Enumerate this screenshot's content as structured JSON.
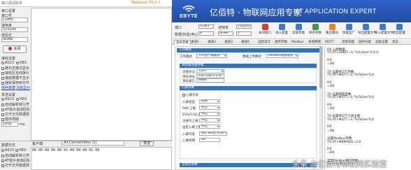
{
  "left_app": {
    "title": "串口调试助手",
    "right_title": "NetAssist V5.0.3",
    "panel": {
      "settings_header": "串口设置",
      "port_label": "串口号",
      "port_value": "COM5",
      "baud_label": "波特率",
      "baud_value": "115200",
      "parity_label": "校验位",
      "parity_value": "NONE",
      "open_button": "关闭",
      "recv_header": "接收设置",
      "recv_ascii": "ASCII",
      "recv_hex": "HEX",
      "recv_opt1": "按日志模式显示",
      "recv_opt2": "接收区自动换行",
      "recv_opt3": "接收数据不显示",
      "recv_opt4": "接收保存到文件",
      "link_save": "保存数据",
      "link_clear": "清除显示",
      "send_header": "发送设置",
      "send_ascii": "ASCII",
      "send_hex": "HEX",
      "send_opt1": "自动解析转义符",
      "send_opt2": "AT指令自动回车",
      "send_opt3": "打开文件数据源",
      "send_opt4": "循环周期",
      "cycle_value": "1000",
      "cycle_unit": "ms"
    },
    "bottom_bar": {
      "data_log": "数据日志",
      "client_label": "客户端:",
      "conn_value": "All Connections (1)",
      "send_button": "发送",
      "send_content": "00 00 00 00 00 01 00 00 00 01 00"
    }
  },
  "right_app": {
    "brand": "EBYTE",
    "title": "亿佰特 · 物联网应用专家",
    "subtitle": "IoT APPLICATION EXPERT",
    "toolbar": {
      "port_label": "端口",
      "port_value": "COM5",
      "baud_label": "波特率",
      "baud_value": "115200",
      "format_label": "数据/校验/停止",
      "data_bits": "8",
      "parity": "NONE",
      "stop_bits": "1",
      "buttons": [
        {
          "label": "关闭端口",
          "color": "#d23c3c"
        },
        {
          "label": "进入配置",
          "color": "#3a7bd5"
        },
        {
          "label": "读取参数",
          "color": "#3a7bd5"
        },
        {
          "label": "保存参数",
          "color": "#3a9a4a"
        },
        {
          "label": "重启模块",
          "color": "#e08a1e"
        },
        {
          "label": "恢复出厂",
          "color": "#3a7bd5"
        },
        {
          "label": "导出配置文件",
          "color": "#3a7bd5"
        },
        {
          "label": "导入配置文件",
          "color": "#3a7bd5"
        },
        {
          "label": "退出配置",
          "color": "#3a7bd5"
        }
      ]
    },
    "tabs": [
      "基本参数",
      "通道1",
      "通道2",
      "通道3",
      "通道4",
      "远程读写",
      "透传参数",
      "Modbus",
      "本地网络",
      "MQTT",
      "其他功能",
      "固件升级",
      "高级设置",
      "状态"
    ],
    "work_mode": {
      "header": "工作模式",
      "mode_label": "工作模式",
      "mode_value": "TCP客户端模式",
      "conv_label": "数据上传模式",
      "conv_value": "Modbus网关模式"
    },
    "target": {
      "header": "目标服务器参数",
      "proto_label": "连接协议",
      "proto_value": "TCPC",
      "ip_label": "目标地址",
      "ip_value": "192.168.0.150",
      "port_label": "目标端口",
      "port_value": "8888"
    },
    "heartbeat": {
      "header": "心跳参数",
      "enable_label": "心跳开关",
      "type_label": "心跳类型",
      "type_value": "网络",
      "mac_label": "MAC上报",
      "mac_value": "开启",
      "rssi_label": "RSSI/CSQ上报",
      "rssi_value": "开启",
      "reg_label": "注册包上报",
      "reg_value": "开启",
      "net_label": "固定心跳上报",
      "net_value": "开启",
      "content_label": "心跳内容",
      "content_value": "Net Keep Alive Pack",
      "period_label": "心跳周期",
      "period_value": "60"
    },
    "footer_header": "注册包参数",
    "log": [
      "RX:心跳数据",
      "TX:AT+GMDT=4,\"Fe1d2ee\"0,0,0",
      "",
      "RX:",
      "=OK",
      "",
      "TX:设置MQTT参数",
      "TX:AT+MQTT=4,\"FeTe2ee\"0,0",
      "",
      "RX:",
      "=OK",
      "",
      "TX:设置网络参数",
      "TX:AT+MQTT=4,\"FeTe2ee\"0,0",
      "",
      "RX:",
      "=OK",
      "",
      "TX:设置MQTT订阅主题",
      "TX:AT+MQTT=4,\"FeTe2ee\"0,0",
      "",
      "RX:",
      "=OK",
      "",
      "设置Modbus参数",
      "TX:AT+MBMODE=2,0",
      "",
      "RX:",
      "=OK",
      "",
      "读取Modbus网关参数",
      "TX:AT+MBMODE=?"
    ]
  },
  "watermark": "头条 @亿佰特物联网实验室"
}
